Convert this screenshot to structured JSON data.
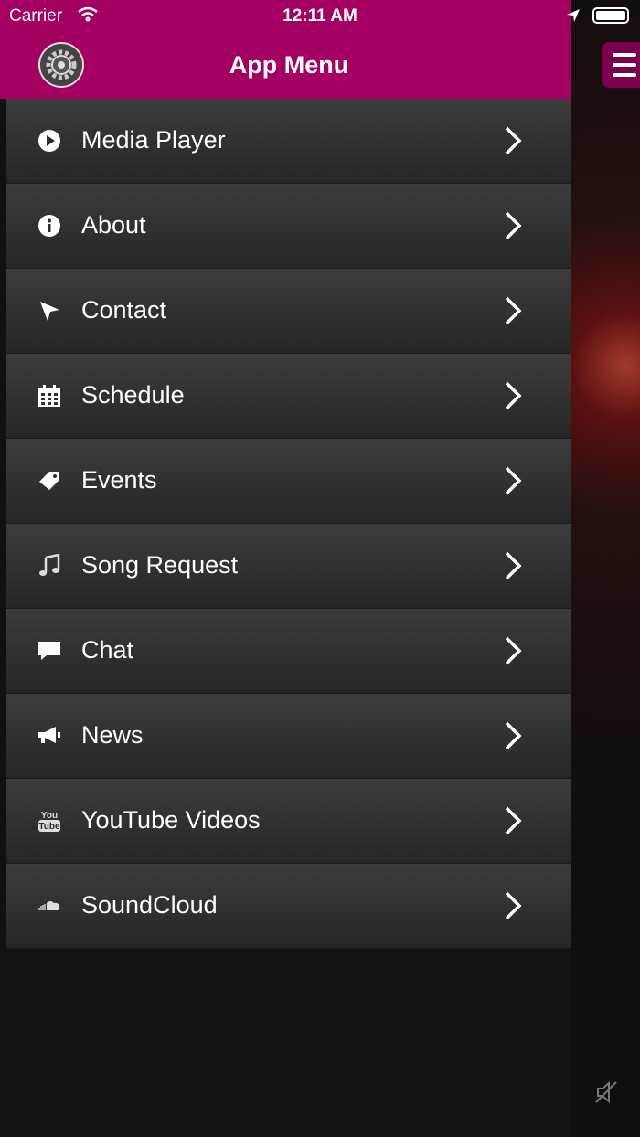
{
  "status_bar": {
    "carrier": "Carrier",
    "time": "12:11 AM"
  },
  "header": {
    "title": "App Menu",
    "settings_icon": "gear-icon",
    "menu_icon": "hamburger-icon"
  },
  "menu": {
    "items": [
      {
        "label": "Media Player",
        "icon": "play-icon"
      },
      {
        "label": "About",
        "icon": "info-icon"
      },
      {
        "label": "Contact",
        "icon": "send-icon"
      },
      {
        "label": "Schedule",
        "icon": "calendar-icon"
      },
      {
        "label": "Events",
        "icon": "ticket-icon"
      },
      {
        "label": "Song Request",
        "icon": "music-note-icon"
      },
      {
        "label": "Chat",
        "icon": "chat-bubble-icon"
      },
      {
        "label": "News",
        "icon": "megaphone-icon"
      },
      {
        "label": "YouTube Videos",
        "icon": "youtube-icon"
      },
      {
        "label": "SoundCloud",
        "icon": "soundcloud-icon"
      }
    ]
  },
  "colors": {
    "header": "#a30062",
    "item_top": "#3c3c3c",
    "item_bottom": "#262626",
    "text": "#ffffff"
  }
}
